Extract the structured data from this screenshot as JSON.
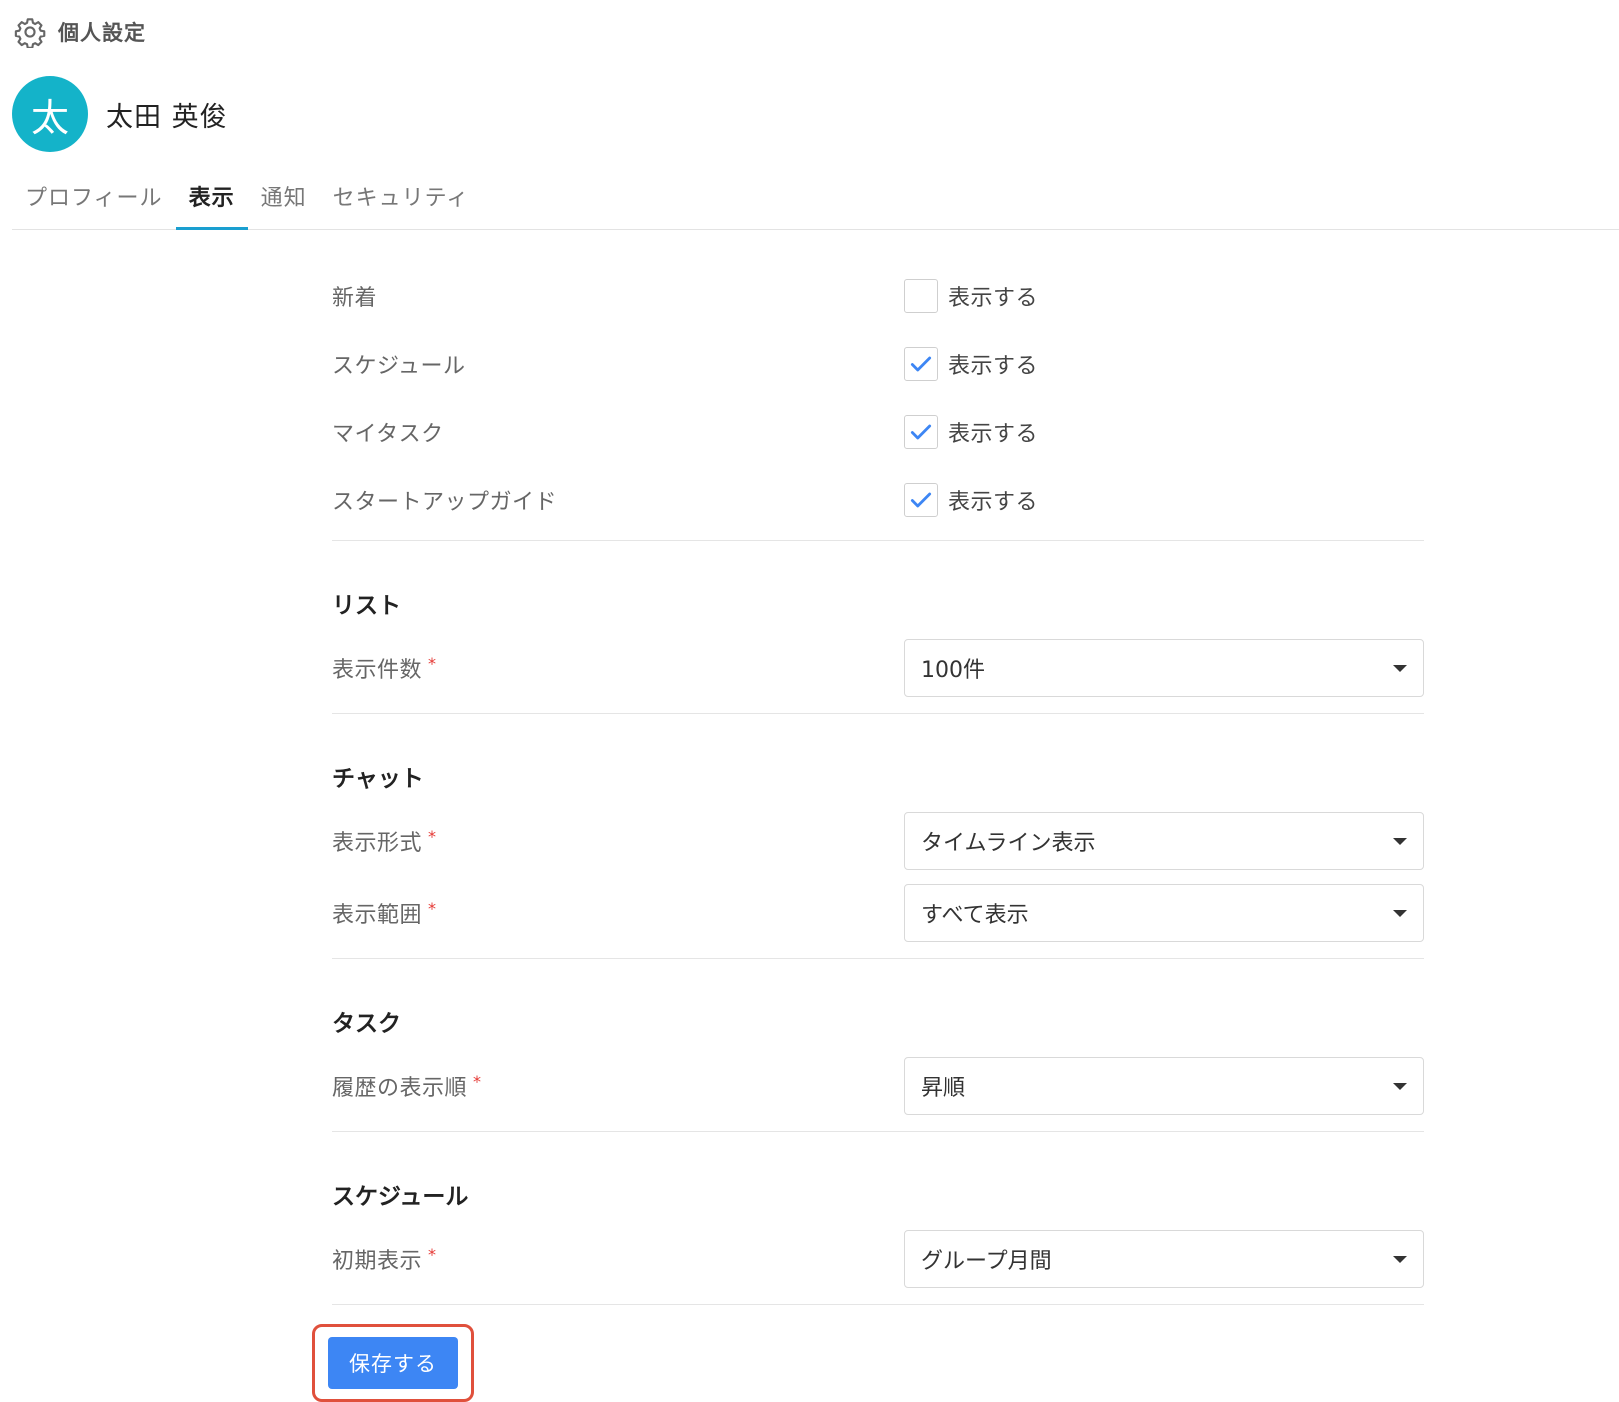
{
  "header": {
    "title": "個人設定",
    "icon": "gear-icon"
  },
  "user": {
    "avatar_char": "太",
    "avatar_color": "#14b3c9",
    "name": "太田 英俊"
  },
  "tabs": [
    {
      "label": "プロフィール",
      "active": false
    },
    {
      "label": "表示",
      "active": true
    },
    {
      "label": "通知",
      "active": false
    },
    {
      "label": "セキュリティ",
      "active": false
    }
  ],
  "display_items": [
    {
      "label": "新着",
      "checkbox_label": "表示する",
      "checked": false
    },
    {
      "label": "スケジュール",
      "checkbox_label": "表示する",
      "checked": true
    },
    {
      "label": "マイタスク",
      "checkbox_label": "表示する",
      "checked": true
    },
    {
      "label": "スタートアップガイド",
      "checkbox_label": "表示する",
      "checked": true
    }
  ],
  "required_mark": "*",
  "sections": {
    "list": {
      "title": "リスト",
      "count_label": "表示件数",
      "count_value": "100件"
    },
    "chat": {
      "title": "チャット",
      "format_label": "表示形式",
      "format_value": "タイムライン表示",
      "range_label": "表示範囲",
      "range_value": "すべて表示"
    },
    "task": {
      "title": "タスク",
      "order_label": "履歴の表示順",
      "order_value": "昇順"
    },
    "schedule": {
      "title": "スケジュール",
      "initial_label": "初期表示",
      "initial_value": "グループ月間"
    }
  },
  "save_button": {
    "label": "保存する",
    "color": "#3d86f4"
  },
  "colors": {
    "accent": "#1a9fd0",
    "check": "#3d86f4",
    "required": "#e53935",
    "highlight": "#e0503c"
  }
}
